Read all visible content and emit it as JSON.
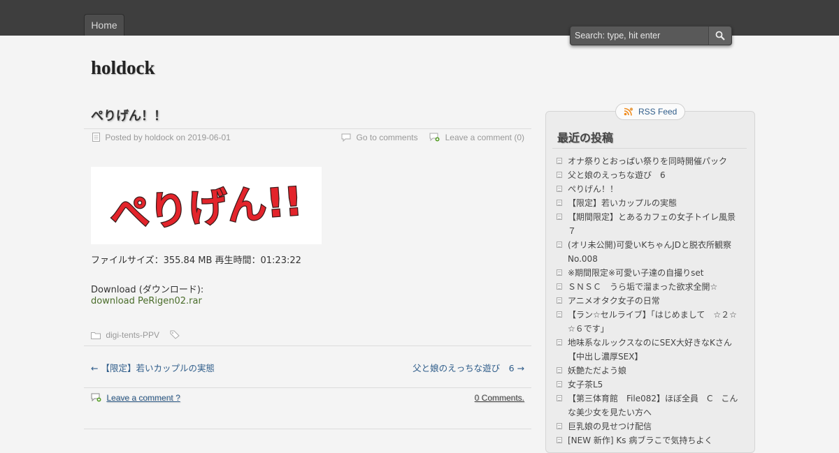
{
  "nav": {
    "home_label": "Home"
  },
  "search": {
    "placeholder": "Search: type, hit enter"
  },
  "site": {
    "title": "holdock"
  },
  "post": {
    "title": "ぺりげん！！",
    "meta_posted": "Posted by holdock on 2019-06-01",
    "go_to_comments": "Go to comments",
    "leave_comment": "Leave a comment (0)",
    "banner_text": "ぺりげん!!",
    "file_info": "ファイルサイズ：355.84 MB 再生時間：01:23:22",
    "download_heading": "Download (ダウンロード):",
    "download_link": "download PeRigen02.rar",
    "category": "digi-tents-PPV"
  },
  "post_nav": {
    "prev": "← 【限定】若いカップルの実態",
    "next": "父と娘のえっちな遊び　6 →"
  },
  "comments": {
    "leave_comment": "Leave a comment ?",
    "count": "0 Comments."
  },
  "sidebar": {
    "rss_label": "RSS Feed",
    "widget_title": "最近の投稿",
    "recent_posts": [
      "オナ祭りとおっぱい祭りを同時開催パック",
      "父と娘のえっちな遊び　6",
      "ぺりげん！！",
      "【限定】若いカップルの実態",
      "【期間限定】とあるカフェの女子トイレ風景７",
      "(オリ未公開)可愛いKちゃんJDと脱衣所観察No.008",
      "※期間限定※可愛い子達の自撮りset",
      "ＳＮＳＣ　うら垢で溜まった欲求全開☆",
      "アニメオタク女子の日常",
      "【ラン☆セルライブ】「はじめまして　☆２☆　☆６です」",
      "地味系なルックスなのにSEX大好きなKさん【中出し濃厚SEX】",
      "妖艶ただよう娘",
      "女子茶L5",
      "【第三体育館　File082】ほぼ全員　C　こんな美少女を見たい方へ",
      "巨乳娘の見せつけ配信",
      "[NEW 新作] Ks 病ブラこで気持ちよく"
    ]
  },
  "colors": {
    "topbar": "#3e3e3e",
    "background": "#f4f4f4",
    "link_blue": "#2f5d8a",
    "download_green": "#4a6d2a",
    "banner_red": "#e3242b"
  }
}
